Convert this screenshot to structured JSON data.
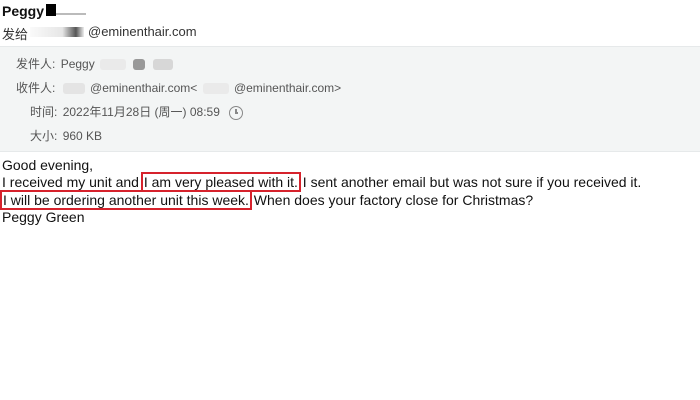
{
  "header": {
    "sender_name": "Peggy",
    "sendto_label": "发给",
    "sendto_email": "@eminenthair.com"
  },
  "meta": {
    "from_label": "发件人:",
    "from_value": "Peggy",
    "to_label": "收件人:",
    "to_value_1": "@eminenthair.com<",
    "to_value_2": "@eminenthair.com>",
    "time_label": "时间:",
    "time_value": "2022年11月28日 (周一) 08:59",
    "size_label": "大小:",
    "size_value": "960 KB"
  },
  "body": {
    "greeting": "Good evening,",
    "line2_a": "I received my unit and ",
    "line2_highlight": "I am very pleased with it.",
    "line2_b": " I sent another email but was not sure if you  received it.",
    "line3_highlight": "I will be ordering another unit this  week.",
    "line3_b": " When does your factory close for Christmas?",
    "signature": "Peggy Green"
  },
  "colors": {
    "highlight_border": "#d6222c",
    "meta_background": "#f3f5f5"
  }
}
